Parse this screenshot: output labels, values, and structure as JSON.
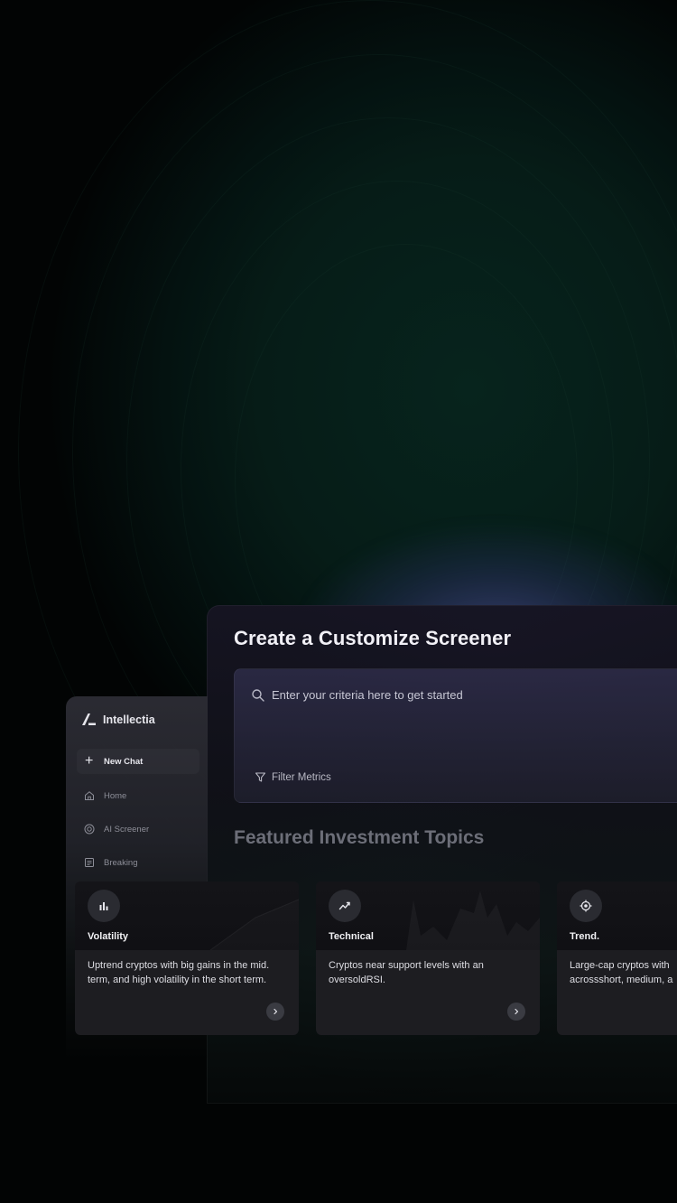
{
  "main": {
    "title": "Create a Customize Screener",
    "search": {
      "placeholder": "Enter your criteria here to get started"
    },
    "filter_label": "Filter Metrics",
    "featured_title": "Featured Investment Topics"
  },
  "sidebar": {
    "brand": "Intellectia",
    "new_chat": "New Chat",
    "items": [
      {
        "label": "Home",
        "icon": "home-icon"
      },
      {
        "label": "AI Screener",
        "icon": "screener-icon"
      },
      {
        "label": "Breaking",
        "icon": "news-icon"
      }
    ]
  },
  "cards": [
    {
      "title": "Volatility",
      "icon": "bar-chart-icon",
      "description": "Uptrend cryptos with big gains in the mid.\nterm, and high volatility in the short term."
    },
    {
      "title": "Technical",
      "icon": "trend-line-icon",
      "description": "Cryptos near support levels with an\noversoldRSI."
    },
    {
      "title": "Trend.",
      "icon": "target-icon",
      "description": "Large-cap cryptos with\nacrossshort, medium, a"
    }
  ],
  "colors": {
    "background": "#020303",
    "panel": "#16141f",
    "accent_glow": "#5e58b4",
    "card": "#1d1d21"
  }
}
